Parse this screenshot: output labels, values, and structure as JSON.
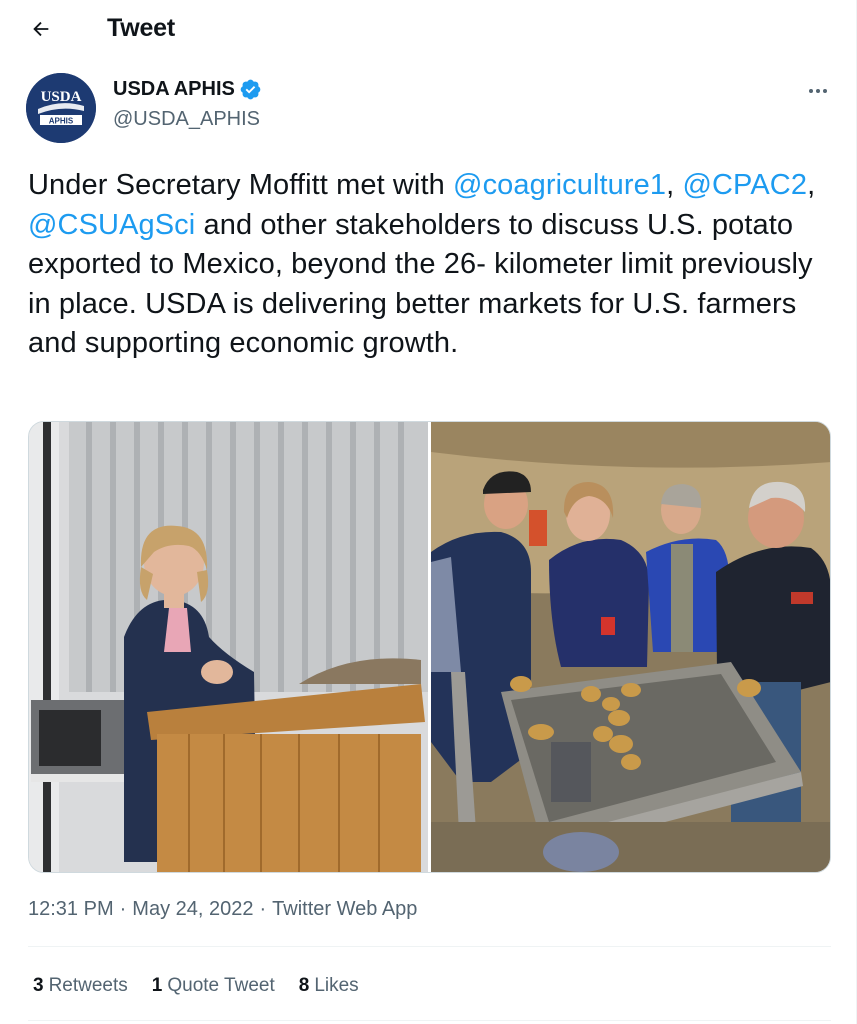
{
  "header": {
    "title": "Tweet"
  },
  "author": {
    "display_name": "USDA APHIS",
    "handle": "@USDA_APHIS",
    "avatar_text_top": "USDA",
    "avatar_text_bottom": "APHIS"
  },
  "tweet": {
    "segments": [
      {
        "text": "Under Secretary Moffitt met with ",
        "mention": false
      },
      {
        "text": "@coagriculture1",
        "mention": true
      },
      {
        "text": ", ",
        "mention": false
      },
      {
        "text": "@CPAC2",
        "mention": true
      },
      {
        "text": ", ",
        "mention": false
      },
      {
        "text": "@CSUAgSci",
        "mention": true
      },
      {
        "text": " and other stakeholders to discuss U.S. potato exported to Mexico, beyond the 26- kilometer limit previously in place. USDA is delivering better markets for U.S. farmers and supporting economic growth.",
        "mention": false
      }
    ]
  },
  "meta": {
    "time": "12:31 PM",
    "separator": "·",
    "date": "May 24, 2022",
    "source": "Twitter Web App"
  },
  "stats": [
    {
      "count": "3",
      "label": "Retweets"
    },
    {
      "count": "1",
      "label": "Quote Tweet"
    },
    {
      "count": "8",
      "label": "Likes"
    }
  ],
  "colors": {
    "accent": "#1d9bf0",
    "text": "#0f1419",
    "muted": "#536471",
    "border": "#eff3f4"
  },
  "icons": {
    "back": "arrow-left-icon",
    "verified": "verified-badge-icon",
    "more": "more-horizontal-icon"
  }
}
